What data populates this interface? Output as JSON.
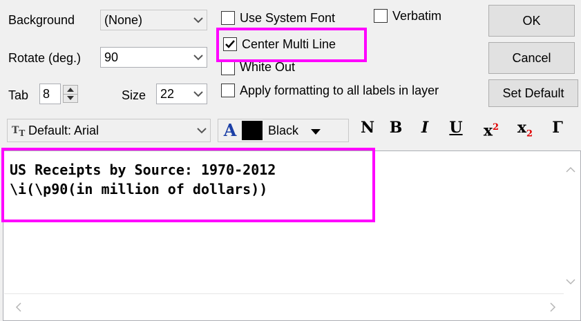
{
  "background": {
    "label": "Background",
    "value": "(None)"
  },
  "rotate": {
    "label": "Rotate (deg.)",
    "value": "90"
  },
  "tab": {
    "label": "Tab",
    "value": "8"
  },
  "size": {
    "label": "Size",
    "value": "22"
  },
  "options": {
    "use_system_font": {
      "label": "Use System Font",
      "checked": false
    },
    "verbatim": {
      "label": "Verbatim",
      "checked": false
    },
    "center_multi_line": {
      "label": "Center Multi Line",
      "checked": true
    },
    "white_out": {
      "label": "White Out",
      "checked": false
    },
    "apply_all": {
      "label": "Apply formatting to all labels in layer",
      "checked": false
    }
  },
  "buttons": {
    "ok": "OK",
    "cancel": "Cancel",
    "set_default": "Set Default"
  },
  "font": {
    "value": "Default: Arial",
    "icon": "truetype-icon"
  },
  "color": {
    "glyph": "A",
    "swatch": "#000000",
    "name": "Black"
  },
  "format_buttons": {
    "normal": "N",
    "bold": "B",
    "italic": "I",
    "underline": "U",
    "superscript": "x",
    "superscript_mark": "2",
    "subscript": "x",
    "subscript_mark": "2",
    "greek": "Γ"
  },
  "editor": {
    "lines": [
      "US Receipts by Source: 1970-2012",
      "\\i(\\p90(in million of dollars))"
    ]
  },
  "colors": {
    "highlight": "#ff00ff",
    "accent_blue": "#1b3fa6",
    "script_red": "#e00000"
  }
}
